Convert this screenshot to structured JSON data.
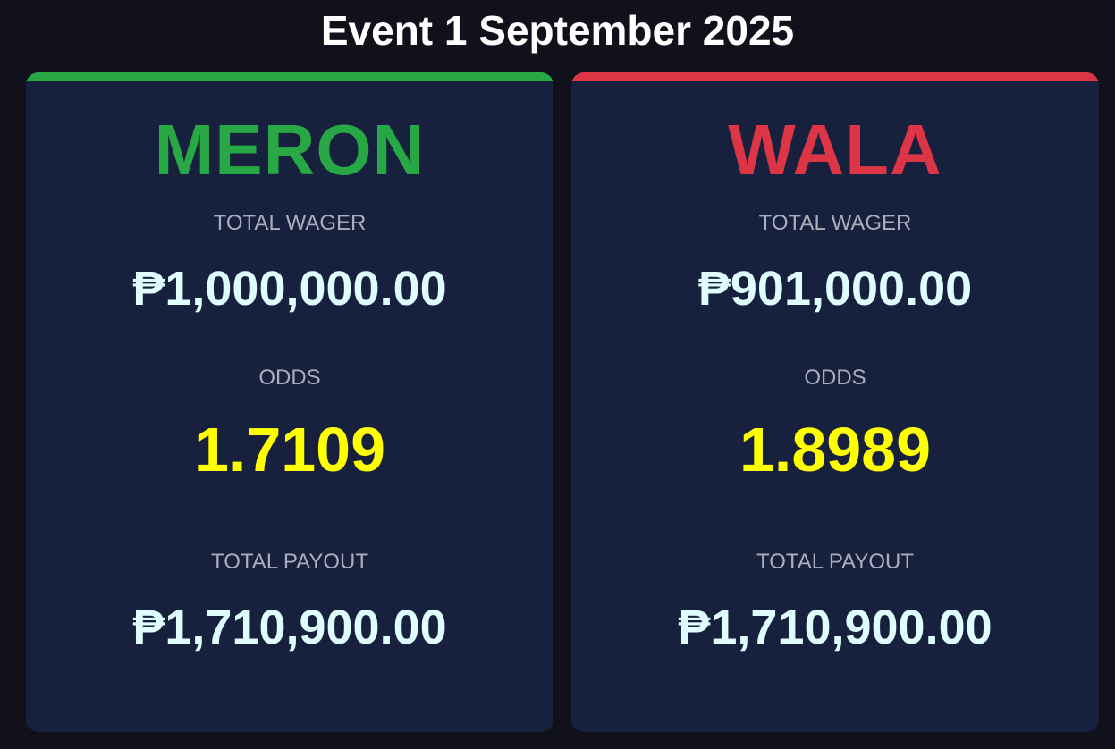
{
  "title": "Event 1 September 2025",
  "colors": {
    "meron": "#28a745",
    "wala": "#dc3545",
    "odds": "#ffff00",
    "amount": "#dffcff"
  },
  "meron": {
    "name": "MERON",
    "total_wager_label": "TOTAL WAGER",
    "total_wager": "₱1,000,000.00",
    "odds_label": "ODDS",
    "odds": "1.7109",
    "total_payout_label": "TOTAL PAYOUT",
    "total_payout": "₱1,710,900.00"
  },
  "wala": {
    "name": "WALA",
    "total_wager_label": "TOTAL WAGER",
    "total_wager": "₱901,000.00",
    "odds_label": "ODDS",
    "odds": "1.8989",
    "total_payout_label": "TOTAL PAYOUT",
    "total_payout": "₱1,710,900.00"
  }
}
